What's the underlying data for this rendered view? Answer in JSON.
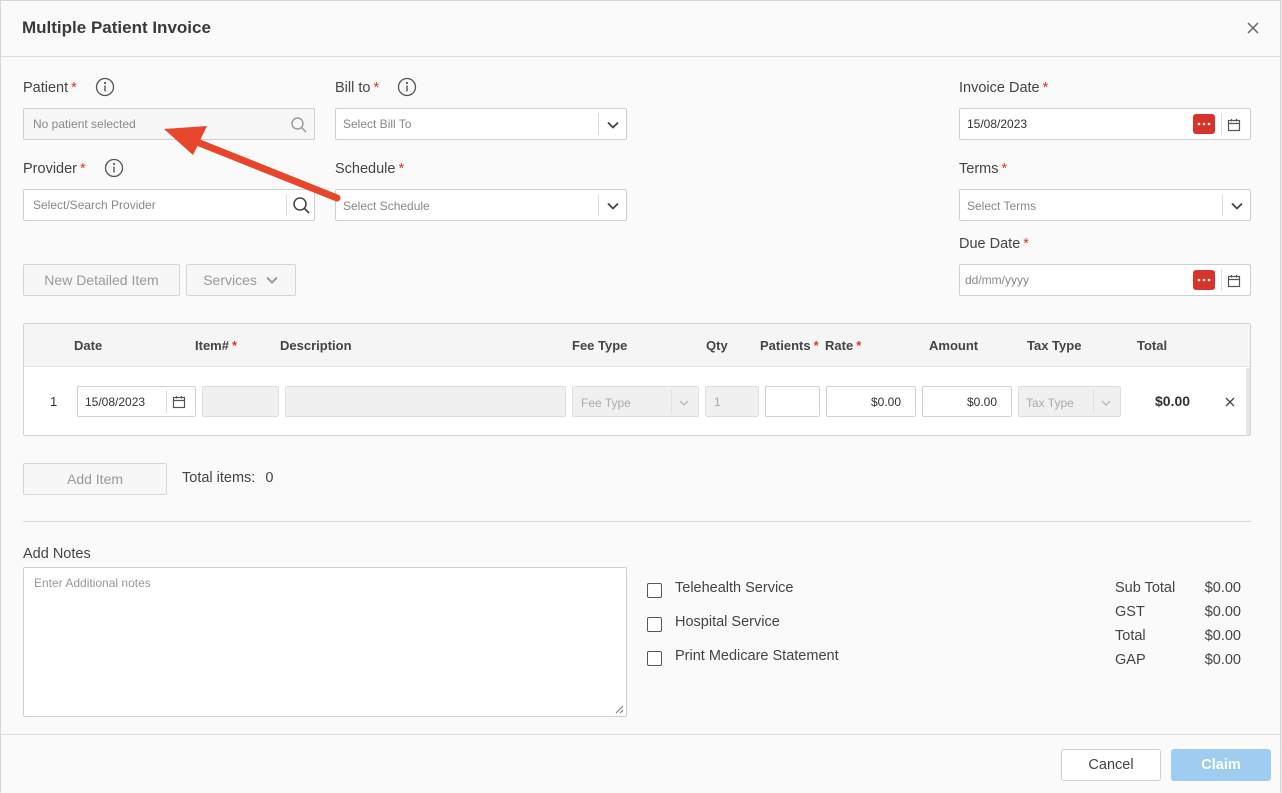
{
  "modal": {
    "title": "Multiple Patient Invoice"
  },
  "patient": {
    "label": "Patient",
    "required": "*",
    "placeholder": "No patient selected"
  },
  "bill_to": {
    "label": "Bill to",
    "required": "*",
    "placeholder": "Select Bill To"
  },
  "invoice_date": {
    "label": "Invoice Date",
    "required": "*",
    "value": "15/08/2023"
  },
  "provider": {
    "label": "Provider",
    "required": "*",
    "placeholder": "Select/Search Provider"
  },
  "schedule": {
    "label": "Schedule",
    "required": "*",
    "placeholder": "Select Schedule"
  },
  "terms": {
    "label": "Terms",
    "required": "*",
    "placeholder": "Select Terms"
  },
  "due_date": {
    "label": "Due Date",
    "required": "*",
    "placeholder": "dd/mm/yyyy"
  },
  "toolbar": {
    "new_detailed_item": "New Detailed Item",
    "services": "Services"
  },
  "table": {
    "headers": {
      "date": "Date",
      "item": "Item#",
      "description": "Description",
      "fee_type": "Fee Type",
      "qty": "Qty",
      "patients": "Patients",
      "rate": "Rate",
      "amount": "Amount",
      "tax_type": "Tax Type",
      "total": "Total",
      "req": "*"
    },
    "rows": [
      {
        "num": "1",
        "date": "15/08/2023",
        "fee_type": "Fee Type",
        "qty": "1",
        "rate": "$0.00",
        "amount": "$0.00",
        "tax_type": "Tax Type",
        "total": "$0.00"
      }
    ]
  },
  "items": {
    "add_item": "Add Item",
    "total_label": "Total items:",
    "total_count": "0"
  },
  "notes": {
    "label": "Add Notes",
    "placeholder": "Enter Additional notes"
  },
  "options": {
    "telehealth": "Telehealth Service",
    "hospital": "Hospital Service",
    "medicare": "Print Medicare Statement"
  },
  "summary": {
    "sub_total_label": "Sub Total",
    "sub_total": "$0.00",
    "gst_label": "GST",
    "gst": "$0.00",
    "total_label": "Total",
    "total": "$0.00",
    "gap_label": "GAP",
    "gap": "$0.00"
  },
  "footer": {
    "cancel": "Cancel",
    "claim": "Claim"
  },
  "colors": {
    "required": "#d9342b",
    "calendar_button": "#d9342b",
    "claim_button": "#9fcdf1",
    "annotation_arrow": "#e8462a"
  },
  "icons": [
    "close-icon",
    "info-icon",
    "search-icon",
    "chevron-down-icon",
    "calendar-icon",
    "calendar-picker-icon",
    "remove-row-icon"
  ]
}
